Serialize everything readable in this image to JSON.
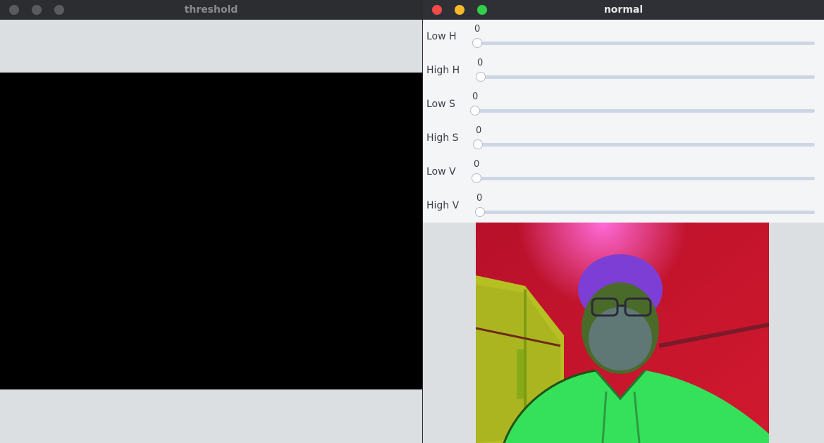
{
  "windows": {
    "threshold": {
      "title": "threshold"
    },
    "normal": {
      "title": "normal",
      "trackbars": [
        {
          "label": "Low H",
          "value": "0"
        },
        {
          "label": "High H",
          "value": "0"
        },
        {
          "label": "Low S",
          "value": "0"
        },
        {
          "label": "High S",
          "value": "0"
        },
        {
          "label": "Low V",
          "value": "0"
        },
        {
          "label": "High V",
          "value": "0"
        }
      ]
    }
  },
  "colors": {
    "close": "#f54a4a",
    "minimize": "#f6b92b",
    "maximize": "#33cf4a",
    "titlebar": "#2f3035",
    "track": "#cfd6e3"
  },
  "icons": {
    "close": "close-icon",
    "minimize": "minimize-icon",
    "maximize": "maximize-icon"
  }
}
